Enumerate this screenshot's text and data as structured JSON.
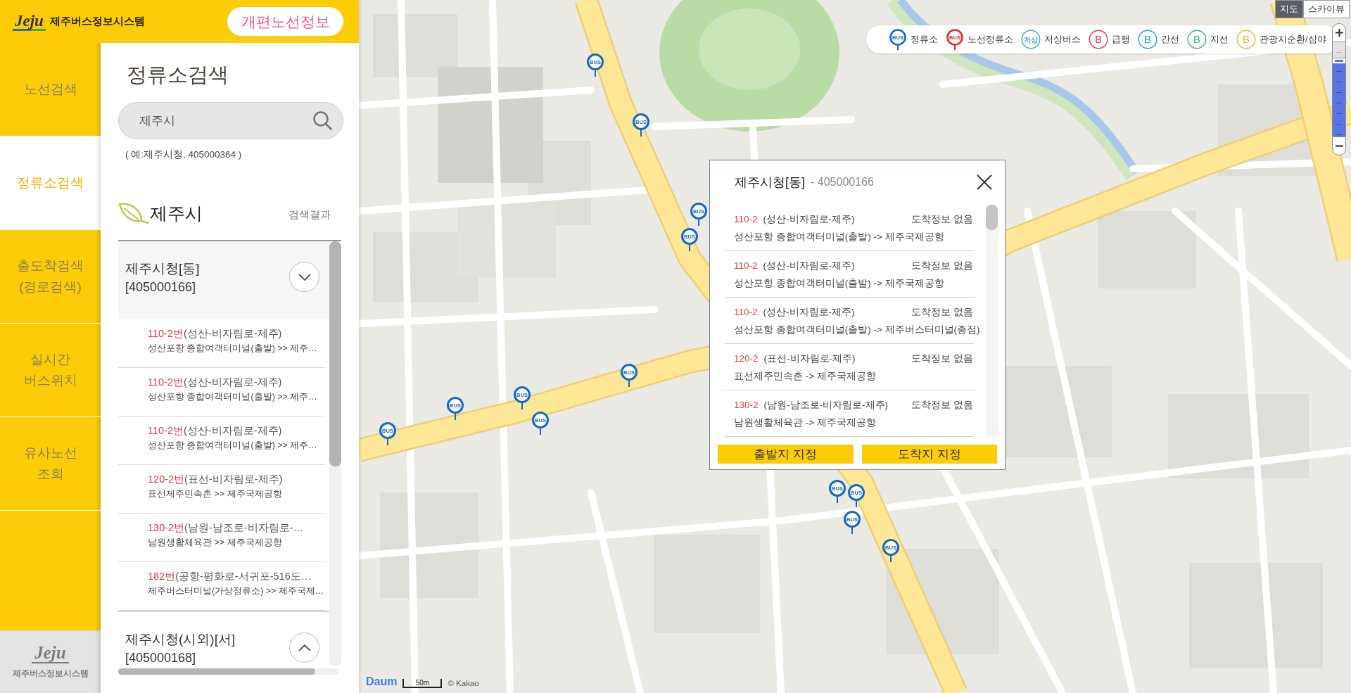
{
  "header": {
    "logo_mark": "Jeju",
    "title": "제주버스정보시스템",
    "notice_button": "개편노선정보"
  },
  "nav": {
    "items": [
      {
        "lines": [
          "노선검색"
        ],
        "selected": false
      },
      {
        "lines": [
          "정류소검색"
        ],
        "selected": true
      },
      {
        "lines": [
          "출도착검색",
          "(경로검색)"
        ],
        "selected": false
      },
      {
        "lines": [
          "실시간",
          "버스위치"
        ],
        "selected": false
      },
      {
        "lines": [
          "유사노선",
          "조회"
        ],
        "selected": false
      }
    ],
    "footer": {
      "logo_mark": "Jeju",
      "title": "제주버스정보시스템"
    }
  },
  "panel": {
    "title": "정류소검색",
    "search": {
      "value": "제주시"
    },
    "hint": "( 예:제주시청, 405000364 )",
    "region": "제주시",
    "result_label": "검색결과",
    "stops": [
      {
        "name": "제주시청[동]",
        "code": "[405000166]",
        "expanded": true,
        "routes": [
          {
            "number": "110-2번",
            "name": "(성산-비자림로-제주)",
            "path": "성산포항 종합여객터미널(출발) >> 제주…"
          },
          {
            "number": "110-2번",
            "name": "(성산-비자림로-제주)",
            "path": "성산포항 종합여객터미널(출발) >> 제주…"
          },
          {
            "number": "110-2번",
            "name": "(성산-비자림로-제주)",
            "path": "성산포항 종합여객터미널(출발) >> 제주…"
          },
          {
            "number": "120-2번",
            "name": "(표선-비자림로-제주)",
            "path": "표선제주민속촌 >> 제주국제공항"
          },
          {
            "number": "130-2번",
            "name": "(남원-남조로-비자림로-…",
            "path": "남원생활체육관 >> 제주국제공항"
          },
          {
            "number": "182번",
            "name": "(공항-평화로-서귀포-516도…",
            "path": "제주버스터미널(가상정류소) >> 제주국제…"
          }
        ]
      },
      {
        "name": "제주시청(시외)[서]",
        "code": "[405000168]",
        "expanded": false
      }
    ]
  },
  "map": {
    "map_types": [
      {
        "label": "지도",
        "selected": true
      },
      {
        "label": "스카이뷰",
        "selected": false
      }
    ],
    "legend": [
      {
        "kind": "pin",
        "symbol": "BUS",
        "label": "정류소",
        "color": "#1669c1"
      },
      {
        "kind": "pin",
        "symbol": "BUS",
        "label": "노선정류소",
        "color": "#e3262b"
      },
      {
        "kind": "ring",
        "symbol": "저상",
        "label": "저상버스",
        "color": "#3aa9e2"
      },
      {
        "kind": "ring",
        "symbol": "B",
        "label": "급행",
        "color": "#e5393b"
      },
      {
        "kind": "ring",
        "symbol": "B",
        "label": "간선",
        "color": "#1ea5dc"
      },
      {
        "kind": "ring",
        "symbol": "B",
        "label": "지선",
        "color": "#39b087"
      },
      {
        "kind": "ring",
        "symbol": "B",
        "label": "관광지순환/심야",
        "color": "#f4b23c"
      }
    ],
    "bus_markers": [
      "BUS",
      "BUS",
      "BUS",
      "BUS",
      "BUS",
      "BUS",
      "BUS",
      "BUS",
      "BUS",
      "BUS",
      "BUS",
      "BUS",
      "BUS"
    ],
    "zoom": {
      "level": 0.8
    },
    "popup": {
      "title": "제주시청[동]",
      "code": "- 405000166",
      "arrivals": [
        {
          "number": "110-2",
          "name": "(성산-비자림로-제주)",
          "status": "도착정보 없음",
          "path": "성산포항 종합여객터미널(출발) -> 제주국제공항"
        },
        {
          "number": "110-2",
          "name": "(성산-비자림로-제주)",
          "status": "도착정보 없음",
          "path": "성산포항 종합여객터미널(출발) -> 제주국제공항"
        },
        {
          "number": "110-2",
          "name": "(성산-비자림로-제주)",
          "status": "도착정보 없음",
          "path": "성산포항 종합여객터미널(출발) -> 제주버스터미널(종점)"
        },
        {
          "number": "120-2",
          "name": "(표선-비자림로-제주)",
          "status": "도착정보 없음",
          "path": "표선제주민속촌 -> 제주국제공항"
        },
        {
          "number": "130-2",
          "name": "(남원-남조로-비자림로-제주)",
          "status": "도착정보 없음",
          "path": "남원생활체육관 -> 제주국제공항"
        }
      ],
      "buttons": [
        "출발지 지정",
        "도착지 지정"
      ]
    },
    "logo": "Daum",
    "scale": "50m",
    "copyright": "© Kakao"
  }
}
